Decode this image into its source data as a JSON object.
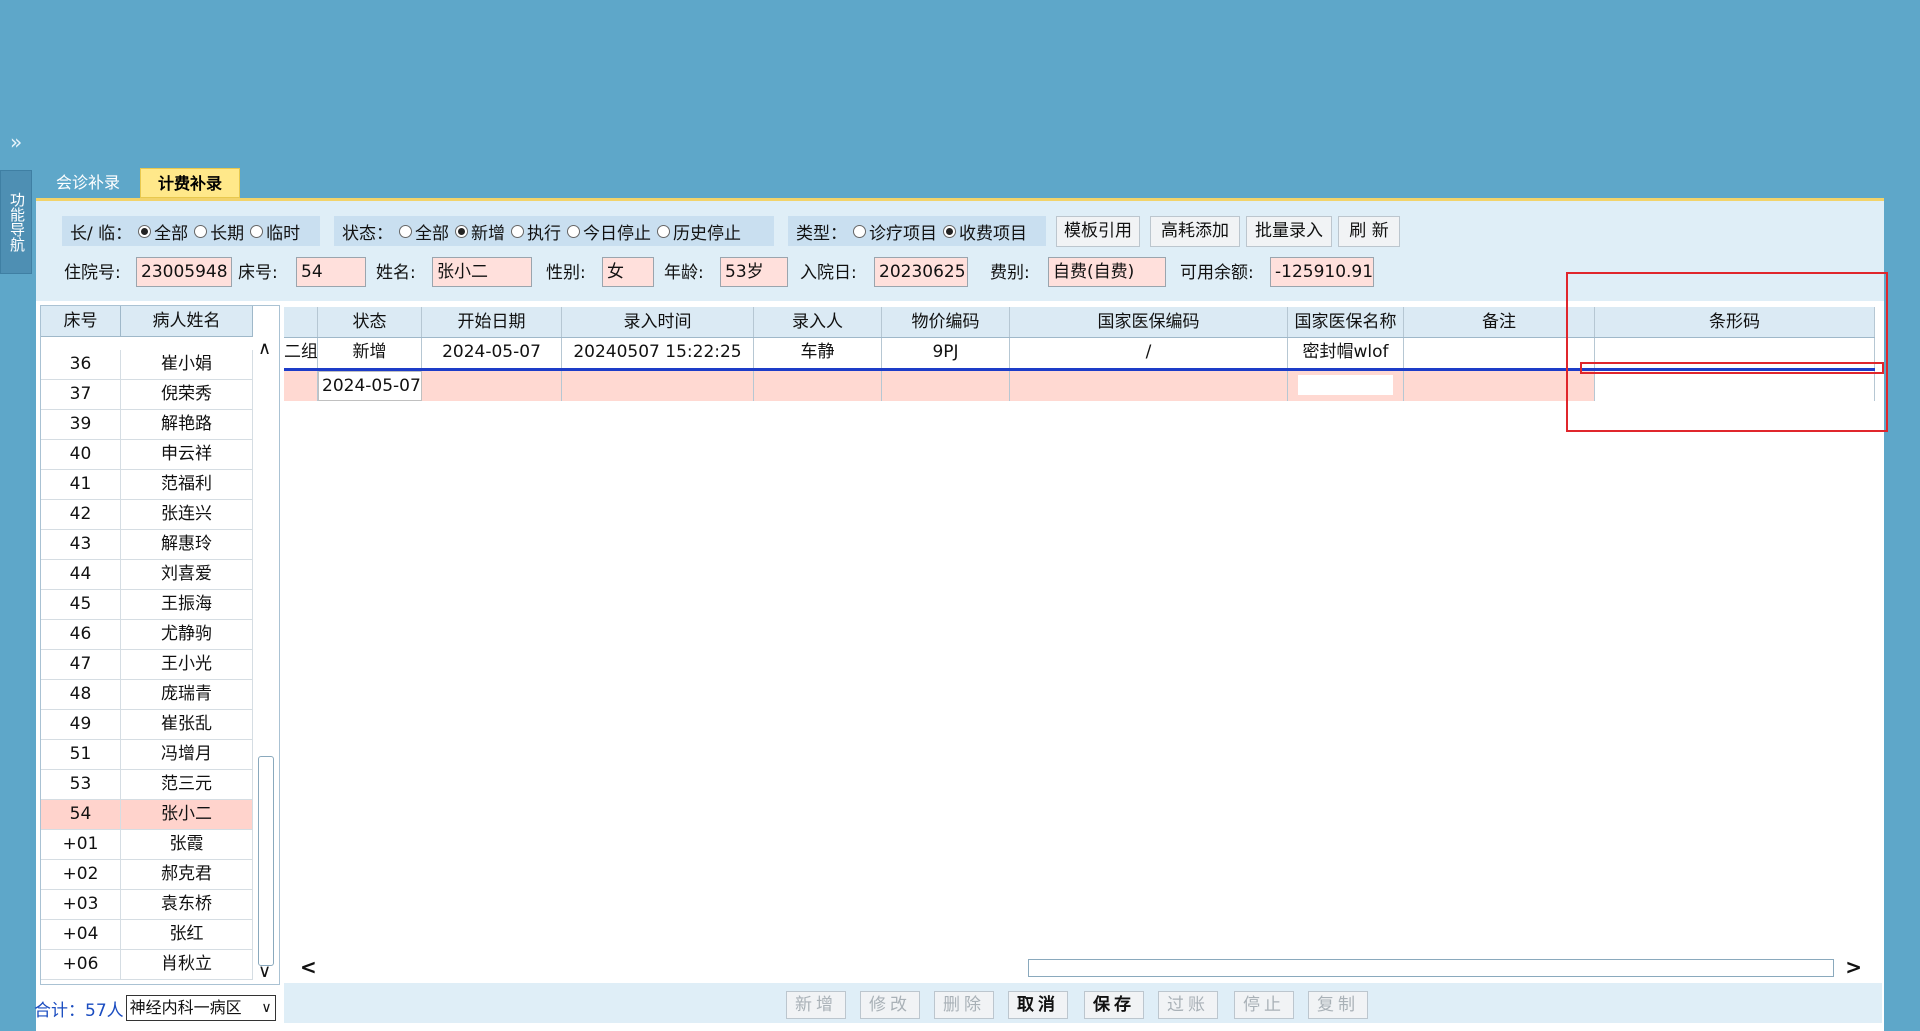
{
  "sidebar": {
    "collapse_glyph": "»",
    "nav_label": "功能导航"
  },
  "tabs": [
    {
      "label": "会诊补录",
      "active": false
    },
    {
      "label": "计费补录",
      "active": true
    }
  ],
  "filters": {
    "long_temp": {
      "label": "长/ 临：",
      "options": [
        {
          "label": "全部",
          "checked": true
        },
        {
          "label": "长期",
          "checked": false
        },
        {
          "label": "临时",
          "checked": false
        }
      ]
    },
    "status": {
      "label": "状态：",
      "options": [
        {
          "label": "全部",
          "checked": false
        },
        {
          "label": "新增",
          "checked": true
        },
        {
          "label": "执行",
          "checked": false
        },
        {
          "label": "今日停止",
          "checked": false
        },
        {
          "label": "历史停止",
          "checked": false
        }
      ]
    },
    "type": {
      "label": "类型：",
      "options": [
        {
          "label": "诊疗项目",
          "checked": false
        },
        {
          "label": "收费项目",
          "checked": true
        }
      ]
    }
  },
  "toolbar": {
    "template_ref": "模板引用",
    "high_cost_add": "高耗添加",
    "batch_entry": "批量录入",
    "refresh": "刷 新"
  },
  "patient": {
    "admission_no_label": "住院号:",
    "admission_no": "23005948",
    "bed_label": "床号:",
    "bed": "54",
    "name_label": "姓名:",
    "name": "张小二",
    "sex_label": "性别:",
    "sex": "女",
    "age_label": "年龄:",
    "age": "53岁",
    "admit_date_label": "入院日:",
    "admit_date": "20230625",
    "fee_type_label": "费别:",
    "fee_type": "自费(自费)",
    "balance_label": "可用余额:",
    "balance": "-125910.91"
  },
  "patient_list": {
    "headers": {
      "bed": "床号",
      "name": "病人姓名"
    },
    "rows": [
      {
        "bed": "36",
        "name": "崔小娟"
      },
      {
        "bed": "37",
        "name": "倪荣秀"
      },
      {
        "bed": "39",
        "name": "解艳路"
      },
      {
        "bed": "40",
        "name": "申云祥"
      },
      {
        "bed": "41",
        "name": "范福利"
      },
      {
        "bed": "42",
        "name": "张连兴"
      },
      {
        "bed": "43",
        "name": "解惠玲"
      },
      {
        "bed": "44",
        "name": "刘喜爱"
      },
      {
        "bed": "45",
        "name": "王振海"
      },
      {
        "bed": "46",
        "name": "尤静驹"
      },
      {
        "bed": "47",
        "name": "王小光"
      },
      {
        "bed": "48",
        "name": "庞瑞青"
      },
      {
        "bed": "49",
        "name": "崔张乱"
      },
      {
        "bed": "51",
        "name": "冯增月"
      },
      {
        "bed": "53",
        "name": "范三元"
      },
      {
        "bed": "54",
        "name": "张小二",
        "selected": true
      },
      {
        "bed": "+01",
        "name": "张霞"
      },
      {
        "bed": "+02",
        "name": "郝克君"
      },
      {
        "bed": "+03",
        "name": "袁东桥"
      },
      {
        "bed": "+04",
        "name": "张红"
      },
      {
        "bed": "+06",
        "name": "肖秋立"
      }
    ],
    "total": "合计：57人",
    "ward": "神经内科一病区"
  },
  "grid": {
    "headers": [
      "",
      "状态",
      "开始日期",
      "录入时间",
      "录入人",
      "物价编码",
      "国家医保编码",
      "国家医保名称",
      "备注",
      "条形码"
    ],
    "rows": [
      {
        "group": "二组",
        "status": "新增",
        "start_date": "2024-05-07",
        "entry_time": "20240507 15:22:25",
        "operator": "车静",
        "price_code": "9PJ",
        "nat_code": "/",
        "nat_name": "密封帽wlof",
        "remark": "",
        "barcode": ""
      }
    ],
    "edit_row": {
      "start_date": "2024-05-07"
    }
  },
  "actions": [
    {
      "label": "新增",
      "enabled": false
    },
    {
      "label": "修改",
      "enabled": false
    },
    {
      "label": "删除",
      "enabled": false
    },
    {
      "label": "取消",
      "enabled": true
    },
    {
      "label": "保存",
      "enabled": true
    },
    {
      "label": "过账",
      "enabled": false
    },
    {
      "label": "停止",
      "enabled": false
    },
    {
      "label": "复制",
      "enabled": false
    }
  ],
  "colors": {
    "background": "#5ea7c9",
    "highlight_box": "#e0262c",
    "selected_row": "#ffd3cc",
    "active_tab": "#ffe88a"
  }
}
